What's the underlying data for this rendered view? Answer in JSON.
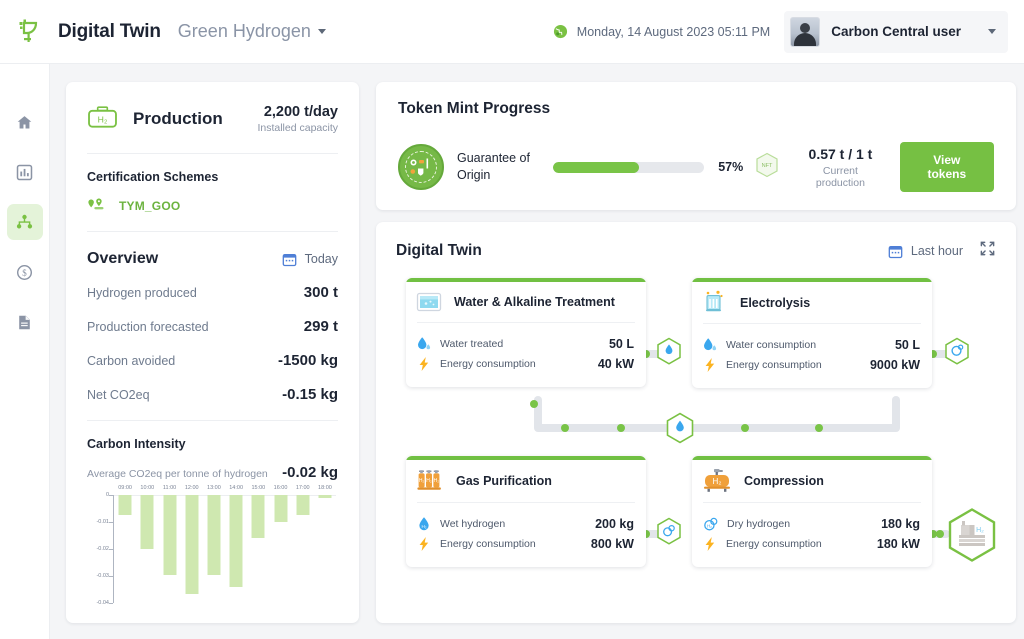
{
  "header": {
    "logo_icon": "leaf-tree-logo-icon",
    "title": "Digital Twin",
    "project": "Green Hydrogen",
    "project_caret_icon": "chevron-down-icon",
    "globe_icon": "globe-icon",
    "datetime": "Monday, 14 August 2023  05:11 PM",
    "user_name": "Carbon Central user",
    "user_caret_icon": "chevron-down-icon",
    "avatar_icon": "user-avatar"
  },
  "sidebar": {
    "items": [
      {
        "name": "home",
        "icon": "home-icon",
        "active": false
      },
      {
        "name": "analytics",
        "icon": "bar-chart-icon",
        "active": false
      },
      {
        "name": "digital-twin",
        "icon": "node-network-icon",
        "active": true
      },
      {
        "name": "finance",
        "icon": "dollar-circle-icon",
        "active": false
      },
      {
        "name": "documents",
        "icon": "document-icon",
        "active": false
      }
    ]
  },
  "production": {
    "icon": "hydrogen-tank-icon",
    "title": "Production",
    "capacity_value": "2,200 t/day",
    "capacity_label": "Installed capacity",
    "certification_title": "Certification Schemes",
    "certification_icon": "location-pin-icon",
    "certification_name": "TYM_GOO",
    "overview_title": "Overview",
    "overview_period_icon": "calendar-icon",
    "overview_period": "Today",
    "stats": [
      {
        "label": "Hydrogen produced",
        "value": "300 t"
      },
      {
        "label": "Production forecasted",
        "value": "299 t"
      },
      {
        "label": "Carbon avoided",
        "value": "-1500 kg"
      },
      {
        "label": "Net CO2eq",
        "value": "-0.15 kg"
      }
    ],
    "carbon_intensity_title": "Carbon Intensity",
    "carbon_intensity_sub": "Average CO2eq per tonne of hydrogen",
    "carbon_intensity_value": "-0.02 kg"
  },
  "chart_data": {
    "type": "bar",
    "title": "Carbon Intensity",
    "subtitle": "Average CO2eq per tonne of hydrogen",
    "xlabel": "",
    "ylabel": "",
    "categories": [
      "09:00",
      "10:00",
      "11:00",
      "12:00",
      "13:00",
      "14:00",
      "15:00",
      "16:00",
      "17:00",
      "18:00"
    ],
    "values": [
      -0.0075,
      -0.02,
      -0.0295,
      -0.0365,
      -0.0295,
      -0.034,
      -0.016,
      -0.01,
      -0.0075,
      -0.001
    ],
    "ylim": [
      -0.04,
      0
    ],
    "yticks": [
      "0",
      "-0.01",
      "-0.02",
      "-0.03",
      "-0.04"
    ],
    "ytick_values": [
      0,
      -0.01,
      -0.02,
      -0.03,
      -0.04
    ],
    "grid": false,
    "legend": null,
    "bar_color": "#cfe8b0"
  },
  "token_mint": {
    "title": "Token Mint Progress",
    "scheme_badge_icon": "guarantee-of-origin-badge",
    "scheme_name": "Guarantee of\nOrigin",
    "scheme_name_line1": "Guarantee of",
    "scheme_name_line2": "Origin",
    "progress_percent": 57,
    "progress_label": "57%",
    "nft_icon": "nft-hexagon-icon",
    "production_ratio": "0.57 t / 1 t",
    "production_label": "Current production",
    "view_tokens_label": "View tokens"
  },
  "digital_twin": {
    "title": "Digital Twin",
    "period_icon": "calendar-icon",
    "period": "Last hour",
    "expand_icon": "expand-fullscreen-icon",
    "nodes": [
      {
        "id": "water-alkaline-treatment",
        "icon": "water-tank-icon",
        "name": "Water & Alkaline Treatment",
        "metrics": [
          {
            "icon": "water-drop-icon",
            "label": "Water treated",
            "value": "50 L"
          },
          {
            "icon": "lightning-bolt-icon",
            "label": "Energy consumption",
            "value": "40 kW"
          }
        ]
      },
      {
        "id": "electrolysis",
        "icon": "electrolysis-beaker-icon",
        "name": "Electrolysis",
        "metrics": [
          {
            "icon": "water-drop-icon",
            "label": "Water consumption",
            "value": "50 L"
          },
          {
            "icon": "lightning-bolt-icon",
            "label": "Energy consumption",
            "value": "9000 kW"
          }
        ]
      },
      {
        "id": "gas-purification",
        "icon": "gas-cylinders-icon",
        "name": "Gas Purification",
        "metrics": [
          {
            "icon": "wet-hydrogen-drop-icon",
            "label": "Wet hydrogen",
            "value": "200 kg"
          },
          {
            "icon": "lightning-bolt-icon",
            "label": "Energy consumption",
            "value": "800 kW"
          }
        ]
      },
      {
        "id": "compression",
        "icon": "hydrogen-compressor-icon",
        "name": "Compression",
        "metrics": [
          {
            "icon": "dry-hydrogen-icon",
            "label": "Dry hydrogen",
            "value": "180 kg"
          },
          {
            "icon": "lightning-bolt-icon",
            "label": "Energy consumption",
            "value": "180 kW"
          }
        ]
      }
    ],
    "connectors": [
      {
        "id": "water-token",
        "icon": "water-drop-hex-icon"
      },
      {
        "id": "electrolysis-token",
        "icon": "hydrogen-molecule-hex-icon"
      },
      {
        "id": "mid-pipe-token",
        "icon": "water-drop-hex-icon"
      },
      {
        "id": "purification-token",
        "icon": "hydrogen-pair-hex-icon"
      },
      {
        "id": "output-plant",
        "icon": "hydrogen-plant-hex-icon"
      }
    ]
  },
  "colors": {
    "accent_green": "#76c043",
    "bar_green": "#cfe8b0",
    "text_dark": "#1d2433",
    "text_muted": "#8b94a5",
    "pipe_gray": "#e2e5ea"
  }
}
